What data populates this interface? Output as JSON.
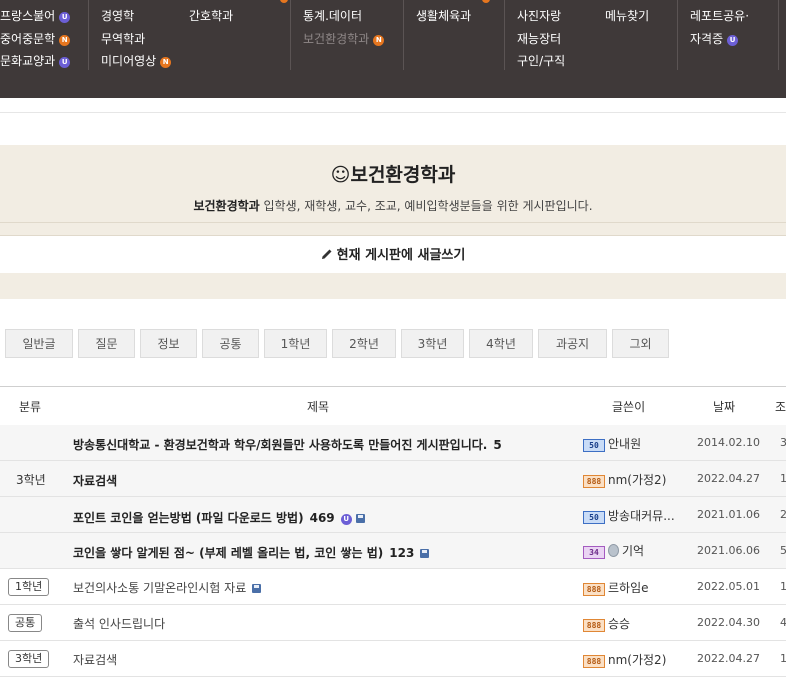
{
  "nav": {
    "col1": [
      {
        "label": "프랑스불어",
        "badge": "U"
      },
      {
        "label": "중어중문학",
        "badge": "N"
      },
      {
        "label": "문화교양과",
        "badge": "U"
      }
    ],
    "col2a": [
      "경영학",
      "무역학과",
      "미디어영상"
    ],
    "col2a_badges": [
      "",
      "",
      "N"
    ],
    "col2b": [
      "간호학과"
    ],
    "col3": [
      {
        "label": "통계.데이터",
        "badge": ""
      },
      {
        "label": "보건환경학과",
        "badge": "N"
      }
    ],
    "col4": [
      "생활체육과"
    ],
    "col5a": [
      "사진자랑",
      "재능장터",
      "구인/구직"
    ],
    "col5b": [
      "메뉴찾기"
    ],
    "col6": [
      {
        "label": "레포트공유·",
        "badge": ""
      },
      {
        "label": "자격증",
        "badge": "U"
      }
    ]
  },
  "board": {
    "title": "☺보건환경학과",
    "desc_bold": "보건환경학과",
    "desc_rest": " 입학생, 재학생, 교수, 조교, 예비입학생분들을 위한 게시판입니다.",
    "write_label": "현재 게시판에 새글쓰기"
  },
  "tabs": [
    "일반글",
    "질문",
    "정보",
    "공통",
    "1학년",
    "2학년",
    "3학년",
    "4학년",
    "과공지",
    "그외"
  ],
  "table": {
    "headers": {
      "category": "분류",
      "title": "제목",
      "author": "글쓴이",
      "date": "날짜",
      "views": "조"
    },
    "rows": [
      {
        "category": "",
        "title": "방송통신대학교 - 환경보건학과 학우/회원들만 사용하도록 만들어진 게시판입니다.",
        "count": "5",
        "level": "50",
        "author": "안내원",
        "date": "2014.02.10",
        "views": "3"
      },
      {
        "category": "3학년",
        "title": "자료검색",
        "count": "",
        "level": "888",
        "author": "nm(가정2)",
        "date": "2022.04.27",
        "views": "1"
      },
      {
        "category": "",
        "title": "포인트 코인을 얻는방법 (파일 다운로드 방법)",
        "count": "469",
        "level": "50",
        "author": "방송대커뮤...",
        "date": "2021.01.06",
        "views": "2"
      },
      {
        "category": "",
        "title": "코인을 쌓다 알게된 점~ (부제 레벨 올리는 법, 코인 쌓는 법)",
        "count": "123",
        "level": "34",
        "author": "기억",
        "date": "2021.06.06",
        "views": "5"
      },
      {
        "category": "1학년",
        "title": "보건의사소통 기말온라인시험 자료",
        "count": "",
        "level": "888",
        "author": "르하임e",
        "date": "2022.05.01",
        "views": "1"
      },
      {
        "category": "공통",
        "title": "출석 인사드립니다",
        "count": "",
        "level": "888",
        "author": "승승",
        "date": "2022.04.30",
        "views": "4"
      },
      {
        "category": "3학년",
        "title": "자료검색",
        "count": "",
        "level": "888",
        "author": "nm(가정2)",
        "date": "2022.04.27",
        "views": "1"
      }
    ]
  }
}
